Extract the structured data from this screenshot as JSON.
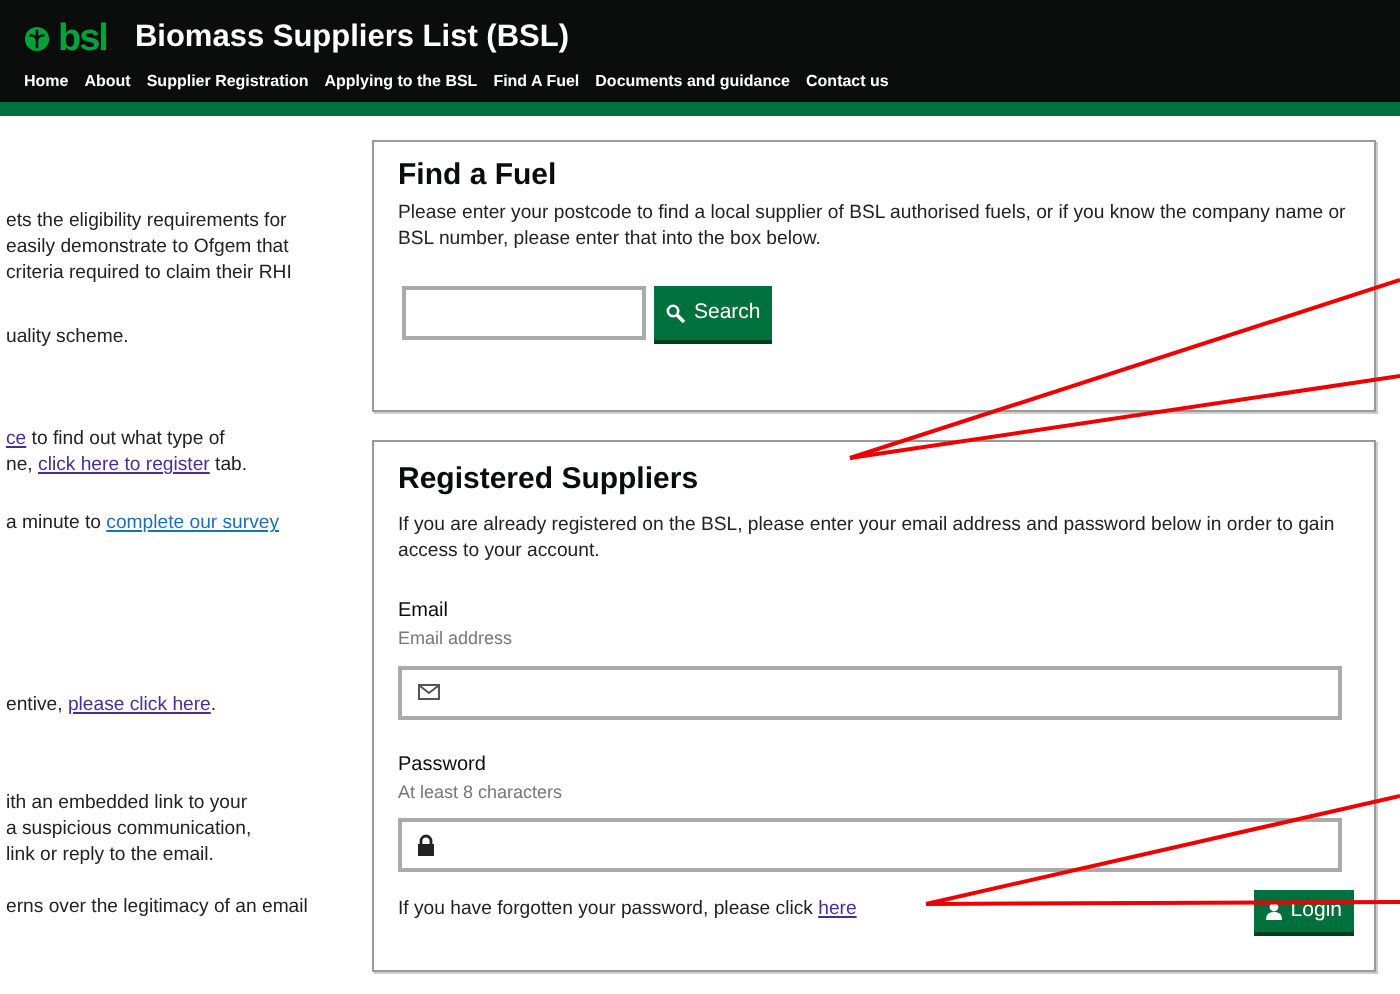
{
  "header": {
    "logo": "bsl",
    "title": "Biomass Suppliers List (BSL)",
    "nav": [
      "Home",
      "About",
      "Supplier Registration",
      "Applying to the BSL",
      "Find A Fuel",
      "Documents and guidance",
      "Contact us"
    ]
  },
  "left_column": [
    {
      "lines": [
        [
          {
            "text": "ets the eligibility requirements for"
          }
        ],
        [
          {
            "text": "easily demonstrate to Ofgem that"
          }
        ],
        [
          {
            "text": "criteria required to claim their RHI"
          }
        ]
      ]
    },
    {
      "lines": [
        [
          {
            "text": "uality scheme."
          }
        ]
      ]
    },
    {
      "lines": [
        [
          {
            "text": "ce",
            "link": true,
            "visited": true
          },
          {
            "text": " to find out what type of"
          }
        ],
        [
          {
            "text": "ne, "
          },
          {
            "text": "click here to register",
            "link": true,
            "visited": true
          },
          {
            "text": " tab."
          }
        ]
      ]
    },
    {
      "lines": [
        [
          {
            "text": "a minute to "
          },
          {
            "text": "complete our survey",
            "link": true,
            "visited": false
          }
        ]
      ]
    },
    {
      "lines": [
        [
          {
            "text": "entive, "
          },
          {
            "text": "please click here",
            "link": true,
            "visited": true
          },
          {
            "text": "."
          }
        ]
      ]
    },
    {
      "lines": [
        [
          {
            "text": "ith an embedded link to your"
          }
        ],
        [
          {
            "text": "a suspicious communication,"
          }
        ],
        [
          {
            "text": "link or reply to the email."
          }
        ]
      ]
    },
    {
      "lines": [
        [
          {
            "text": "erns over the legitimacy of an email"
          }
        ]
      ]
    }
  ],
  "find_fuel": {
    "title": "Find a Fuel",
    "text": "Please enter your postcode to find a local supplier of BSL authorised fuels, or if you know the company name or BSL number, please enter that into the box below.",
    "search_button": "Search"
  },
  "registered_suppliers": {
    "title": "Registered Suppliers",
    "text": "If you are already registered on the BSL, please enter your email address and password below in order to gain access to your account.",
    "fields": [
      {
        "label": "Email",
        "hint": "Email address",
        "kind": "email"
      },
      {
        "label": "Password",
        "hint": "At least 8 characters",
        "kind": "password"
      }
    ],
    "forgot_text": "If you have forgotten your password, please click ",
    "forgot_link": "here",
    "login_button": "Login"
  }
}
